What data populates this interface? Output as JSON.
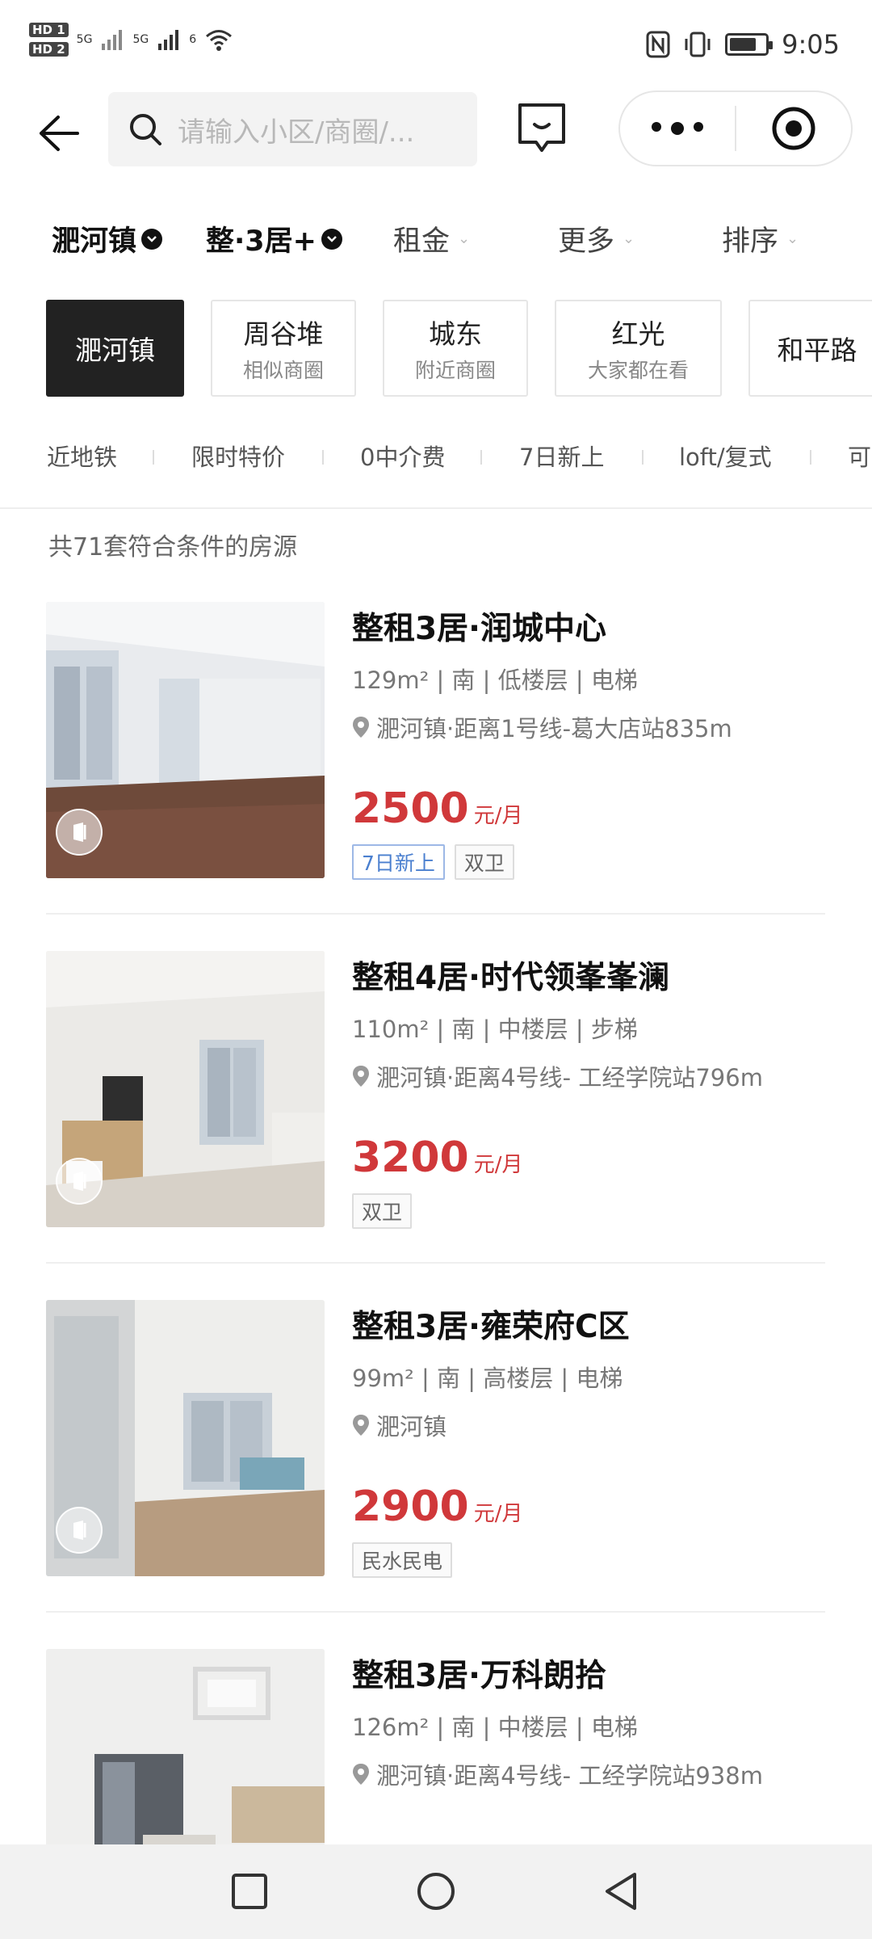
{
  "status_bar": {
    "hd1": "HD 1",
    "hd2": "HD 2",
    "net1": "5G",
    "net2": "5G",
    "wifi_gen": "6",
    "time": "9:05",
    "battery_level": 0.75
  },
  "search": {
    "placeholder": "请输入小区/商圈/..."
  },
  "filters": [
    {
      "label": "淝河镇",
      "active": true
    },
    {
      "label": "整·3居+",
      "active": true
    },
    {
      "label": "租金",
      "active": false
    },
    {
      "label": "更多",
      "active": false
    },
    {
      "label": "排序",
      "active": false
    }
  ],
  "area_chips": [
    {
      "title": "淝河镇",
      "sub": "",
      "active": true
    },
    {
      "title": "周谷堆",
      "sub": "相似商圈",
      "active": false
    },
    {
      "title": "城东",
      "sub": "附近商圈",
      "active": false
    },
    {
      "title": "红光",
      "sub": "大家都在看",
      "active": false
    },
    {
      "title": "和平路",
      "sub": "",
      "active": false
    }
  ],
  "quick_tags": [
    "近地铁",
    "限时特价",
    "0中介费",
    "7日新上",
    "loft/复式",
    "可"
  ],
  "result_count": "共71套符合条件的房源",
  "listings": [
    {
      "title": "整租3居·润城中心",
      "spec": "129m² | 南 | 低楼层 | 电梯",
      "location": "淝河镇·距离1号线-葛大店站835m",
      "price": "2500",
      "unit": "元/月",
      "tags": [
        {
          "text": "7日新上",
          "style": "new"
        },
        {
          "text": "双卫",
          "style": "plain"
        }
      ]
    },
    {
      "title": "整租4居·时代领峯峯澜",
      "spec": "110m² | 南 | 中楼层 | 步梯",
      "location": "淝河镇·距离4号线- 工经学院站796m",
      "price": "3200",
      "unit": "元/月",
      "tags": [
        {
          "text": "双卫",
          "style": "plain"
        }
      ]
    },
    {
      "title": "整租3居·雍荣府C区",
      "spec": "99m² | 南 | 高楼层 | 电梯",
      "location": "淝河镇",
      "price": "2900",
      "unit": "元/月",
      "tags": [
        {
          "text": "民水民电",
          "style": "plain"
        }
      ]
    },
    {
      "title": "整租3居·万科朗拾",
      "spec": "126m² | 南 | 中楼层 | 电梯",
      "location": "淝河镇·距离4号线- 工经学院站938m",
      "price": "",
      "unit": "",
      "tags": []
    }
  ],
  "colors": {
    "price": "#d0383a",
    "new_tag": "#4a7fcf",
    "active_chip": "#222222"
  },
  "icons": {
    "back": "arrow-left-icon",
    "search": "search-icon",
    "message": "message-icon",
    "more": "more-dots-icon",
    "target": "target-icon",
    "location": "location-pin-icon",
    "vr": "vr-icon"
  }
}
